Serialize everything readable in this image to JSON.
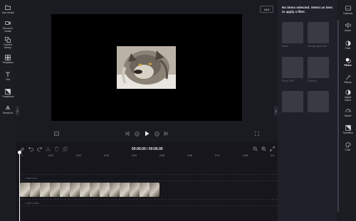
{
  "left_sidebar": {
    "items": [
      {
        "label": "Your media",
        "icon": "folder-icon"
      },
      {
        "label": "Record &\ncreate",
        "icon": "camera-icon"
      },
      {
        "label": "Content\nlibrary",
        "icon": "library-icon"
      },
      {
        "label": "Templates",
        "icon": "templates-icon"
      },
      {
        "label": "Text",
        "icon": "text-icon"
      },
      {
        "label": "Transitions",
        "icon": "transitions-icon"
      },
      {
        "label": "Brand kit",
        "icon": "brand-kit-icon"
      }
    ]
  },
  "preview": {
    "aspect_ratio": "16:9",
    "media_subject": "wolf"
  },
  "timeline": {
    "current_time": "00:00.00",
    "separator": "/",
    "total_time": "00:05.00",
    "ticks": [
      "0",
      "0:01",
      "0:02",
      "0:03",
      "0:04",
      "0:05",
      "0:06",
      "0:07",
      "0:08",
      "0:0"
    ],
    "text_lane_label": "+ Add text",
    "audio_lane_label": "+ Add audio"
  },
  "filters_panel": {
    "title": "No items selected. Select an item to apply a filter.",
    "cards": [
      {
        "label": "None"
      },
      {
        "label": "Vintage gold leaf"
      },
      {
        "label": "Retro VHS"
      },
      {
        "label": "Colorful"
      },
      {
        "label": ""
      },
      {
        "label": ""
      }
    ]
  },
  "right_sidebar": {
    "items": [
      {
        "label": "Captions",
        "icon": "captions-icon"
      },
      {
        "label": "Audio",
        "icon": "audio-icon"
      },
      {
        "label": "Fade",
        "icon": "fade-icon"
      },
      {
        "label": "Filters",
        "icon": "filters-icon",
        "active": true
      },
      {
        "label": "Effects",
        "icon": "effects-icon"
      },
      {
        "label": "Adjust\ncolors",
        "icon": "adjust-colors-icon"
      },
      {
        "label": "Speed",
        "icon": "speed-icon"
      },
      {
        "label": "Transition",
        "icon": "transition-icon"
      },
      {
        "label": "Color",
        "icon": "color-icon"
      }
    ]
  },
  "colors": {
    "background": "#1a1a21",
    "panel": "#20202a",
    "accent": "#ffffff"
  }
}
